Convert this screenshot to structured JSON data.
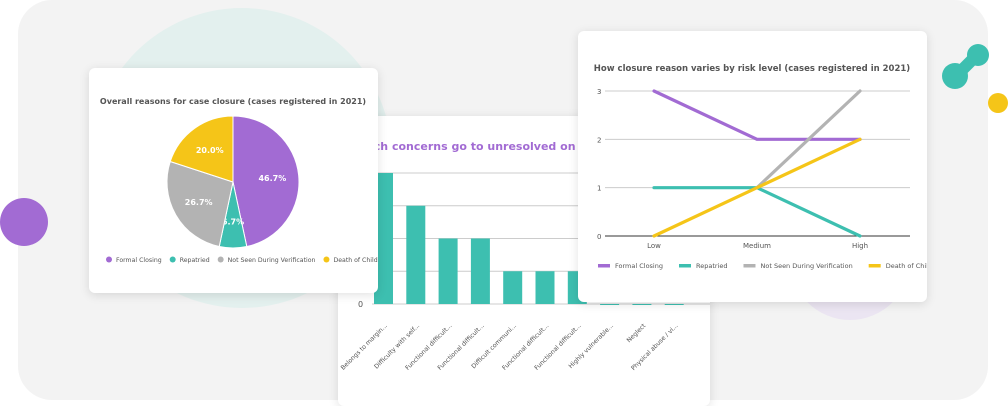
{
  "colors": {
    "purple": "#a26bd3",
    "teal": "#3dbfb0",
    "gray": "#b3b3b3",
    "yellow": "#f5c518",
    "panel": "#f3f3f3",
    "grid": "#cccccc"
  },
  "chart_data": [
    {
      "type": "pie",
      "title": "Overall reasons for case closure (cases registered in 2021)",
      "categories": [
        "Formal Closing",
        "Repatried",
        "Not Seen During Verification",
        "Death of Child"
      ],
      "values": [
        46.7,
        6.7,
        26.7,
        20.0
      ],
      "labels": [
        "46.7%",
        "6.7%",
        "26.7%",
        "20.0%"
      ],
      "legend": "bottom"
    },
    {
      "type": "bar",
      "title": "ich concerns go to unresolved on closed cas",
      "categories": [
        "Belongs to margin...",
        "Difficulty with self...",
        "Functional difficult...",
        "Functional difficult...",
        "Difficult communi...",
        "Functional difficult...",
        "Functional difficult...",
        "Highly vulnerable...",
        "Neglect",
        "Physical abuse / vi..."
      ],
      "values": [
        4,
        3,
        2,
        2,
        1,
        1,
        1,
        0,
        0,
        0
      ],
      "ylim": [
        0,
        4
      ],
      "yticks": [
        "0"
      ],
      "grid": true
    },
    {
      "type": "line",
      "title": "How closure reason varies by risk level (cases registered in 2021)",
      "x": [
        "Low",
        "Medium",
        "High"
      ],
      "yticks": [
        "0",
        "1",
        "2",
        "3"
      ],
      "ylim": [
        0,
        3
      ],
      "grid": true,
      "legend": "bottom",
      "series": [
        {
          "name": "Formal Closing",
          "values": [
            3,
            2,
            2
          ]
        },
        {
          "name": "Repatried",
          "values": [
            1,
            1,
            0
          ]
        },
        {
          "name": "Not Seen During Verification",
          "values": [
            null,
            1,
            3
          ]
        },
        {
          "name": "Death of Child",
          "values": [
            0,
            1,
            2
          ]
        }
      ]
    }
  ]
}
